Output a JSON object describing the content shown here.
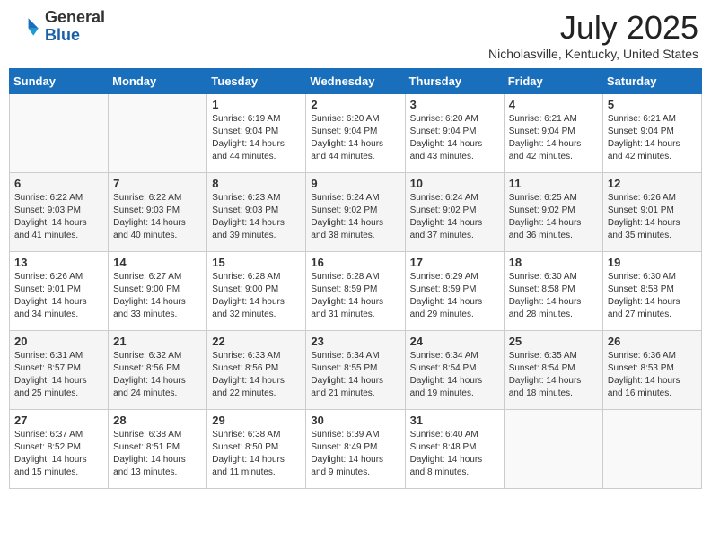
{
  "header": {
    "logo": {
      "general": "General",
      "blue": "Blue"
    },
    "title": "July 2025",
    "location": "Nicholasville, Kentucky, United States"
  },
  "weekdays": [
    "Sunday",
    "Monday",
    "Tuesday",
    "Wednesday",
    "Thursday",
    "Friday",
    "Saturday"
  ],
  "weeks": [
    [
      {
        "day": "",
        "info": ""
      },
      {
        "day": "",
        "info": ""
      },
      {
        "day": "1",
        "info": "Sunrise: 6:19 AM\nSunset: 9:04 PM\nDaylight: 14 hours and 44 minutes."
      },
      {
        "day": "2",
        "info": "Sunrise: 6:20 AM\nSunset: 9:04 PM\nDaylight: 14 hours and 44 minutes."
      },
      {
        "day": "3",
        "info": "Sunrise: 6:20 AM\nSunset: 9:04 PM\nDaylight: 14 hours and 43 minutes."
      },
      {
        "day": "4",
        "info": "Sunrise: 6:21 AM\nSunset: 9:04 PM\nDaylight: 14 hours and 42 minutes."
      },
      {
        "day": "5",
        "info": "Sunrise: 6:21 AM\nSunset: 9:04 PM\nDaylight: 14 hours and 42 minutes."
      }
    ],
    [
      {
        "day": "6",
        "info": "Sunrise: 6:22 AM\nSunset: 9:03 PM\nDaylight: 14 hours and 41 minutes."
      },
      {
        "day": "7",
        "info": "Sunrise: 6:22 AM\nSunset: 9:03 PM\nDaylight: 14 hours and 40 minutes."
      },
      {
        "day": "8",
        "info": "Sunrise: 6:23 AM\nSunset: 9:03 PM\nDaylight: 14 hours and 39 minutes."
      },
      {
        "day": "9",
        "info": "Sunrise: 6:24 AM\nSunset: 9:02 PM\nDaylight: 14 hours and 38 minutes."
      },
      {
        "day": "10",
        "info": "Sunrise: 6:24 AM\nSunset: 9:02 PM\nDaylight: 14 hours and 37 minutes."
      },
      {
        "day": "11",
        "info": "Sunrise: 6:25 AM\nSunset: 9:02 PM\nDaylight: 14 hours and 36 minutes."
      },
      {
        "day": "12",
        "info": "Sunrise: 6:26 AM\nSunset: 9:01 PM\nDaylight: 14 hours and 35 minutes."
      }
    ],
    [
      {
        "day": "13",
        "info": "Sunrise: 6:26 AM\nSunset: 9:01 PM\nDaylight: 14 hours and 34 minutes."
      },
      {
        "day": "14",
        "info": "Sunrise: 6:27 AM\nSunset: 9:00 PM\nDaylight: 14 hours and 33 minutes."
      },
      {
        "day": "15",
        "info": "Sunrise: 6:28 AM\nSunset: 9:00 PM\nDaylight: 14 hours and 32 minutes."
      },
      {
        "day": "16",
        "info": "Sunrise: 6:28 AM\nSunset: 8:59 PM\nDaylight: 14 hours and 31 minutes."
      },
      {
        "day": "17",
        "info": "Sunrise: 6:29 AM\nSunset: 8:59 PM\nDaylight: 14 hours and 29 minutes."
      },
      {
        "day": "18",
        "info": "Sunrise: 6:30 AM\nSunset: 8:58 PM\nDaylight: 14 hours and 28 minutes."
      },
      {
        "day": "19",
        "info": "Sunrise: 6:30 AM\nSunset: 8:58 PM\nDaylight: 14 hours and 27 minutes."
      }
    ],
    [
      {
        "day": "20",
        "info": "Sunrise: 6:31 AM\nSunset: 8:57 PM\nDaylight: 14 hours and 25 minutes."
      },
      {
        "day": "21",
        "info": "Sunrise: 6:32 AM\nSunset: 8:56 PM\nDaylight: 14 hours and 24 minutes."
      },
      {
        "day": "22",
        "info": "Sunrise: 6:33 AM\nSunset: 8:56 PM\nDaylight: 14 hours and 22 minutes."
      },
      {
        "day": "23",
        "info": "Sunrise: 6:34 AM\nSunset: 8:55 PM\nDaylight: 14 hours and 21 minutes."
      },
      {
        "day": "24",
        "info": "Sunrise: 6:34 AM\nSunset: 8:54 PM\nDaylight: 14 hours and 19 minutes."
      },
      {
        "day": "25",
        "info": "Sunrise: 6:35 AM\nSunset: 8:54 PM\nDaylight: 14 hours and 18 minutes."
      },
      {
        "day": "26",
        "info": "Sunrise: 6:36 AM\nSunset: 8:53 PM\nDaylight: 14 hours and 16 minutes."
      }
    ],
    [
      {
        "day": "27",
        "info": "Sunrise: 6:37 AM\nSunset: 8:52 PM\nDaylight: 14 hours and 15 minutes."
      },
      {
        "day": "28",
        "info": "Sunrise: 6:38 AM\nSunset: 8:51 PM\nDaylight: 14 hours and 13 minutes."
      },
      {
        "day": "29",
        "info": "Sunrise: 6:38 AM\nSunset: 8:50 PM\nDaylight: 14 hours and 11 minutes."
      },
      {
        "day": "30",
        "info": "Sunrise: 6:39 AM\nSunset: 8:49 PM\nDaylight: 14 hours and 9 minutes."
      },
      {
        "day": "31",
        "info": "Sunrise: 6:40 AM\nSunset: 8:48 PM\nDaylight: 14 hours and 8 minutes."
      },
      {
        "day": "",
        "info": ""
      },
      {
        "day": "",
        "info": ""
      }
    ]
  ]
}
